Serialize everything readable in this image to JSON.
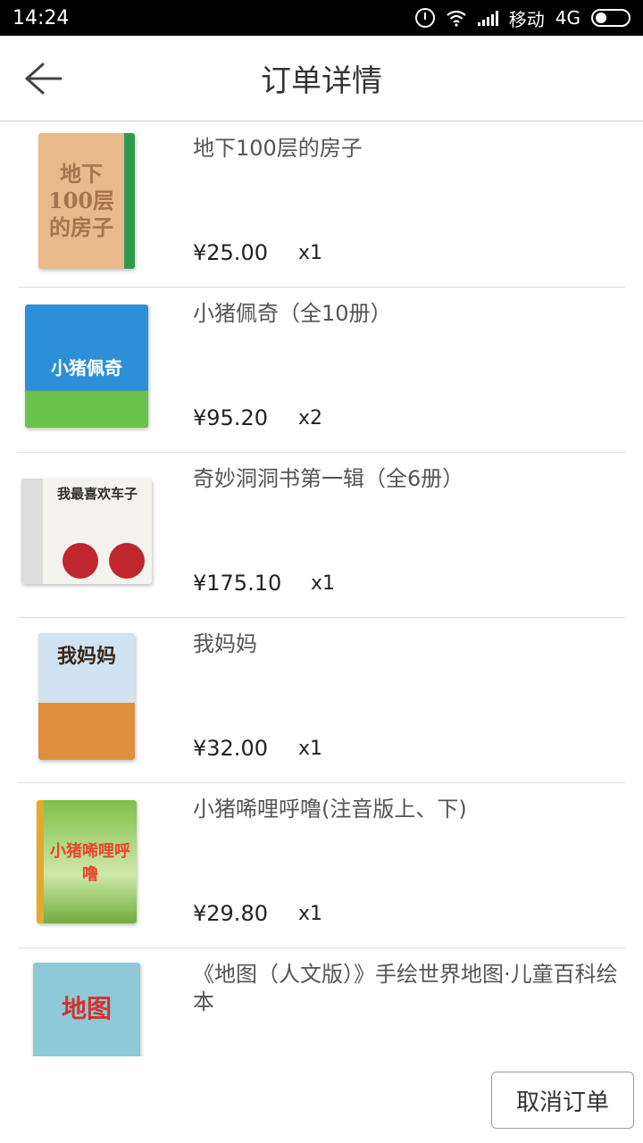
{
  "status_bar": {
    "time": "14:24",
    "carrier": "移动",
    "network": "4G"
  },
  "header": {
    "title": "订单详情",
    "back_icon": "arrow-left-icon"
  },
  "items": [
    {
      "title": "地下100层的房子",
      "price": "¥25.00",
      "qty": "x1",
      "cover_text": "地下100层的房子"
    },
    {
      "title": "小猪佩奇（全10册）",
      "price": "¥95.20",
      "qty": "x2",
      "cover_text": "小猪佩奇"
    },
    {
      "title": "奇妙洞洞书第一辑（全6册）",
      "price": "¥175.10",
      "qty": "x1",
      "cover_text": "我最喜欢车子"
    },
    {
      "title": "我妈妈",
      "price": "¥32.00",
      "qty": "x1",
      "cover_text": "我妈妈"
    },
    {
      "title": "小猪唏哩呼噜(注音版上、下)",
      "price": "¥29.80",
      "qty": "x1",
      "cover_text": "小猪唏哩呼噜"
    },
    {
      "title": "《地图（人文版）》手绘世界地图·儿童百科绘本",
      "price": "",
      "qty": "",
      "cover_text": "地图"
    }
  ],
  "footer": {
    "cancel_label": "取消订单"
  },
  "colors": {
    "status_bar_bg": "#000000",
    "divider": "#dcdcdc",
    "title_text": "#555555"
  }
}
